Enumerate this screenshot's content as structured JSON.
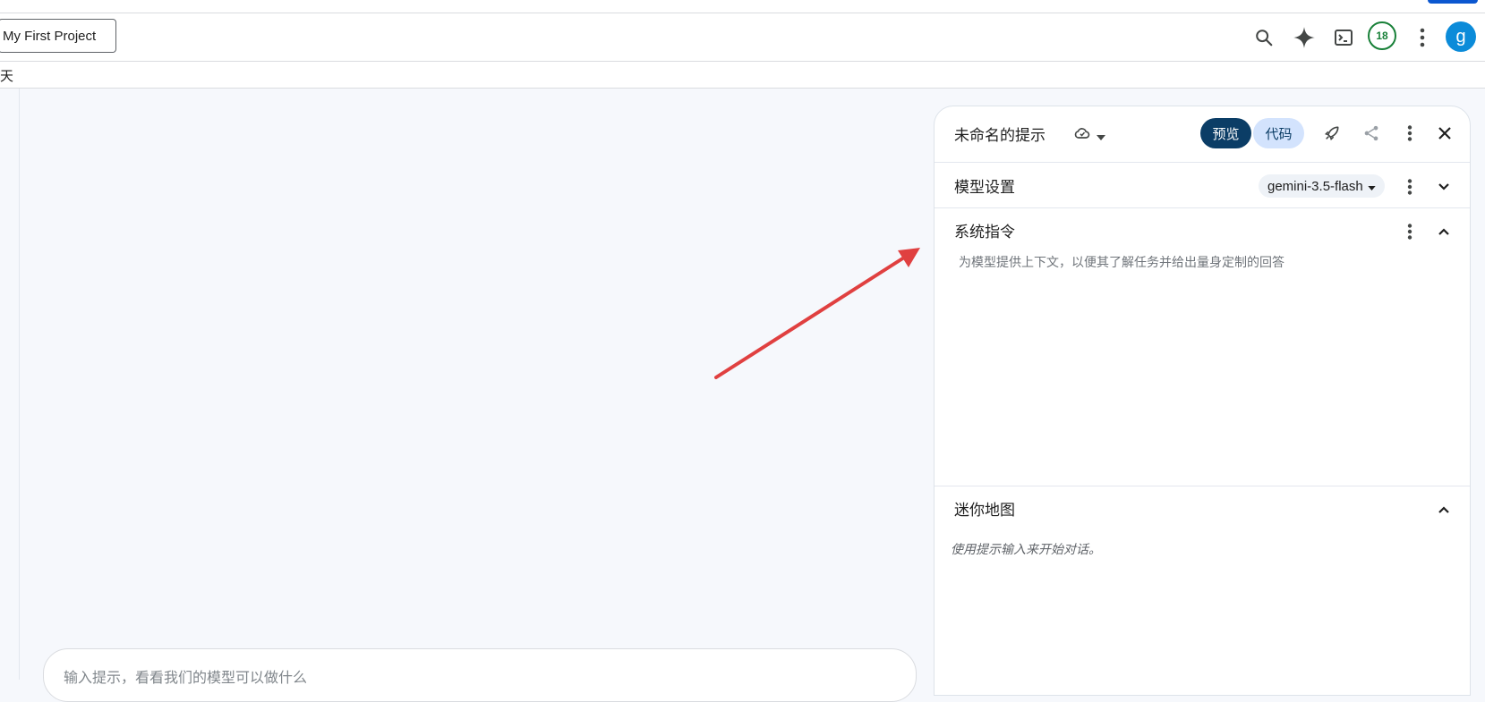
{
  "header": {
    "project_label": "My First Project",
    "badge_count": "18",
    "avatar_letter": "g",
    "icons": [
      "search-icon",
      "sparkle-icon",
      "terminal-icon",
      "more-vert-icon"
    ]
  },
  "subbar": {
    "tab_text": "天"
  },
  "prompt_input": {
    "placeholder": "输入提示，看看我们的模型可以做什么"
  },
  "panel": {
    "title": "未命名的提示",
    "preview_label": "预览",
    "code_label": "代码",
    "model_settings": {
      "title": "模型设置",
      "model_value": "gemini-3.5-flash"
    },
    "system_instructions": {
      "title": "系统指令",
      "placeholder": "为模型提供上下文，以便其了解任务并给出量身定制的回答"
    },
    "minimap": {
      "title": "迷你地图",
      "hint": "使用提示输入来开始对话。"
    }
  },
  "colors": {
    "accent": "#0b57d0",
    "preview_bg": "#0b3d66",
    "code_bg": "#d3e3fd",
    "badge": "#188038",
    "avatar": "#0b8bd9",
    "annotation_arrow": "#e04040"
  }
}
